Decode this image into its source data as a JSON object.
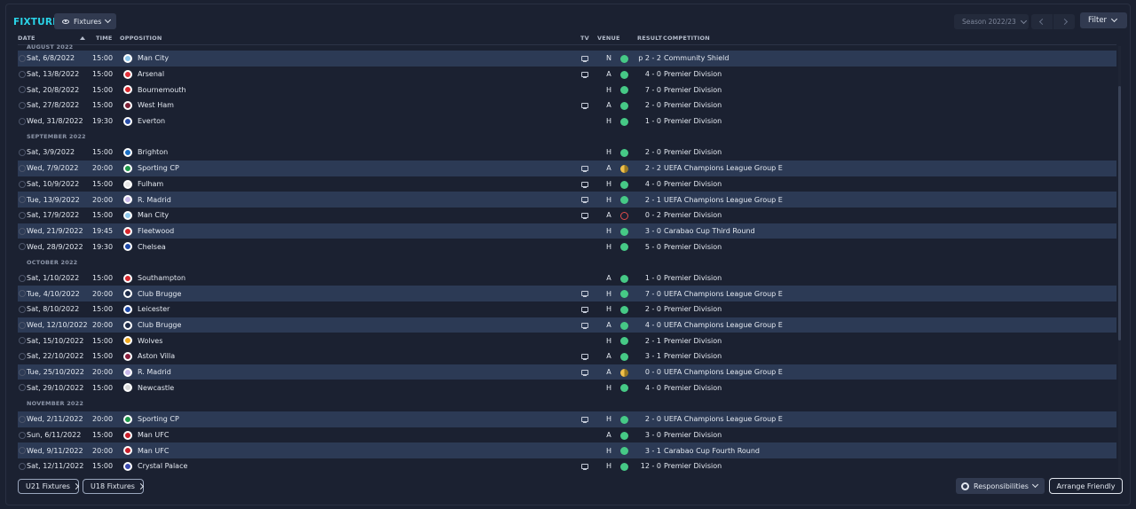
{
  "header": {
    "title": "FIXTURES",
    "view_label": "Fixtures",
    "season_label": "Season 2022/23",
    "filter_label": "Filter"
  },
  "columns": {
    "date": "DATE",
    "time": "TIME",
    "opposition": "OPPOSITION",
    "tv": "TV",
    "venue": "VENUE",
    "result": "RESULT",
    "competition": "COMPETITION"
  },
  "months": [
    "AUGUST 2022",
    "SEPTEMBER 2022",
    "OCTOBER 2022",
    "NOVEMBER 2022"
  ],
  "fixtures": [
    {
      "date": "Sat, 6/8/2022",
      "time": "15:00",
      "opposition": "Man City",
      "tv": true,
      "venue": "N",
      "outcome": "win",
      "score": "p 2 - 2",
      "competition": "Community Shield",
      "highlight": true,
      "crest_color": "#8ec8ec"
    },
    {
      "date": "Sat, 13/8/2022",
      "time": "15:00",
      "opposition": "Arsenal",
      "tv": true,
      "venue": "A",
      "outcome": "win",
      "score": "4 - 0",
      "competition": "Premier Division",
      "highlight": false,
      "crest_color": "#e0313a"
    },
    {
      "date": "Sat, 20/8/2022",
      "time": "15:00",
      "opposition": "Bournemouth",
      "tv": false,
      "venue": "H",
      "outcome": "win",
      "score": "7 - 0",
      "competition": "Premier Division",
      "highlight": false,
      "crest_color": "#d8262c"
    },
    {
      "date": "Sat, 27/8/2022",
      "time": "15:00",
      "opposition": "West Ham",
      "tv": true,
      "venue": "A",
      "outcome": "win",
      "score": "2 - 0",
      "competition": "Premier Division",
      "highlight": false,
      "crest_color": "#7a2036"
    },
    {
      "date": "Wed, 31/8/2022",
      "time": "19:30",
      "opposition": "Everton",
      "tv": false,
      "venue": "H",
      "outcome": "win",
      "score": "1 - 0",
      "competition": "Premier Division",
      "highlight": false,
      "crest_color": "#2a4ea8"
    },
    {
      "date": "Sat, 3/9/2022",
      "time": "15:00",
      "opposition": "Brighton",
      "tv": false,
      "venue": "H",
      "outcome": "win",
      "score": "2 - 0",
      "competition": "Premier Division",
      "highlight": false,
      "crest_color": "#1b6fc4"
    },
    {
      "date": "Wed, 7/9/2022",
      "time": "20:00",
      "opposition": "Sporting CP",
      "tv": true,
      "venue": "A",
      "outcome": "draw",
      "score": "2 - 2",
      "competition": "UEFA Champions League Group E",
      "highlight": true,
      "crest_color": "#1e9a4a"
    },
    {
      "date": "Sat, 10/9/2022",
      "time": "15:00",
      "opposition": "Fulham",
      "tv": true,
      "venue": "H",
      "outcome": "win",
      "score": "4 - 0",
      "competition": "Premier Division",
      "highlight": false,
      "crest_color": "#e8e8e8"
    },
    {
      "date": "Tue, 13/9/2022",
      "time": "20:00",
      "opposition": "R. Madrid",
      "tv": true,
      "venue": "H",
      "outcome": "win",
      "score": "2 - 1",
      "competition": "UEFA Champions League Group E",
      "highlight": true,
      "crest_color": "#c9b8ea"
    },
    {
      "date": "Sat, 17/9/2022",
      "time": "15:00",
      "opposition": "Man City",
      "tv": true,
      "venue": "A",
      "outcome": "loss",
      "score": "0 - 2",
      "competition": "Premier Division",
      "highlight": false,
      "crest_color": "#8ec8ec"
    },
    {
      "date": "Wed, 21/9/2022",
      "time": "19:45",
      "opposition": "Fleetwood",
      "tv": false,
      "venue": "H",
      "outcome": "win",
      "score": "3 - 0",
      "competition": "Carabao Cup Third Round",
      "highlight": true,
      "crest_color": "#d8262c"
    },
    {
      "date": "Wed, 28/9/2022",
      "time": "19:30",
      "opposition": "Chelsea",
      "tv": false,
      "venue": "H",
      "outcome": "win",
      "score": "5 - 0",
      "competition": "Premier Division",
      "highlight": false,
      "crest_color": "#1d48a8"
    },
    {
      "date": "Sat, 1/10/2022",
      "time": "15:00",
      "opposition": "Southampton",
      "tv": false,
      "venue": "A",
      "outcome": "win",
      "score": "1 - 0",
      "competition": "Premier Division",
      "highlight": false,
      "crest_color": "#d8262c"
    },
    {
      "date": "Tue, 4/10/2022",
      "time": "20:00",
      "opposition": "Club Brugge",
      "tv": true,
      "venue": "H",
      "outcome": "win",
      "score": "7 - 0",
      "competition": "UEFA Champions League Group E",
      "highlight": true,
      "crest_color": "#1e2c4a"
    },
    {
      "date": "Sat, 8/10/2022",
      "time": "15:00",
      "opposition": "Leicester",
      "tv": true,
      "venue": "H",
      "outcome": "win",
      "score": "2 - 0",
      "competition": "Premier Division",
      "highlight": false,
      "crest_color": "#1d48a8"
    },
    {
      "date": "Wed, 12/10/2022",
      "time": "20:00",
      "opposition": "Club Brugge",
      "tv": true,
      "venue": "A",
      "outcome": "win",
      "score": "4 - 0",
      "competition": "UEFA Champions League Group E",
      "highlight": true,
      "crest_color": "#1e2c4a"
    },
    {
      "date": "Sat, 15/10/2022",
      "time": "15:00",
      "opposition": "Wolves",
      "tv": false,
      "venue": "H",
      "outcome": "win",
      "score": "2 - 1",
      "competition": "Premier Division",
      "highlight": false,
      "crest_color": "#f0a81e"
    },
    {
      "date": "Sat, 22/10/2022",
      "time": "15:00",
      "opposition": "Aston Villa",
      "tv": true,
      "venue": "A",
      "outcome": "win",
      "score": "3 - 1",
      "competition": "Premier Division",
      "highlight": false,
      "crest_color": "#8a1e3c"
    },
    {
      "date": "Tue, 25/10/2022",
      "time": "20:00",
      "opposition": "R. Madrid",
      "tv": true,
      "venue": "A",
      "outcome": "draw",
      "score": "0 - 0",
      "competition": "UEFA Champions League Group E",
      "highlight": true,
      "crest_color": "#c9b8ea"
    },
    {
      "date": "Sat, 29/10/2022",
      "time": "15:00",
      "opposition": "Newcastle",
      "tv": false,
      "venue": "H",
      "outcome": "win",
      "score": "4 - 0",
      "competition": "Premier Division",
      "highlight": false,
      "crest_color": "#d8d8d8"
    },
    {
      "date": "Wed, 2/11/2022",
      "time": "20:00",
      "opposition": "Sporting CP",
      "tv": true,
      "venue": "H",
      "outcome": "win",
      "score": "2 - 0",
      "competition": "UEFA Champions League Group E",
      "highlight": true,
      "crest_color": "#1e9a4a"
    },
    {
      "date": "Sun, 6/11/2022",
      "time": "15:00",
      "opposition": "Man UFC",
      "tv": false,
      "venue": "A",
      "outcome": "win",
      "score": "3 - 0",
      "competition": "Premier Division",
      "highlight": false,
      "crest_color": "#c81e2a"
    },
    {
      "date": "Wed, 9/11/2022",
      "time": "20:00",
      "opposition": "Man UFC",
      "tv": false,
      "venue": "H",
      "outcome": "win",
      "score": "3 - 1",
      "competition": "Carabao Cup Fourth Round",
      "highlight": true,
      "crest_color": "#c81e2a"
    },
    {
      "date": "Sat, 12/11/2022",
      "time": "15:00",
      "opposition": "Crystal Palace",
      "tv": true,
      "venue": "H",
      "outcome": "win",
      "score": "12 - 0",
      "competition": "Premier Division",
      "highlight": false,
      "crest_color": "#3a4ab0"
    }
  ],
  "footer": {
    "u21_label": "U21 Fixtures",
    "u18_label": "U18 Fixtures",
    "responsibilities_label": "Responsibilities",
    "arrange_label": "Arrange Friendly"
  }
}
